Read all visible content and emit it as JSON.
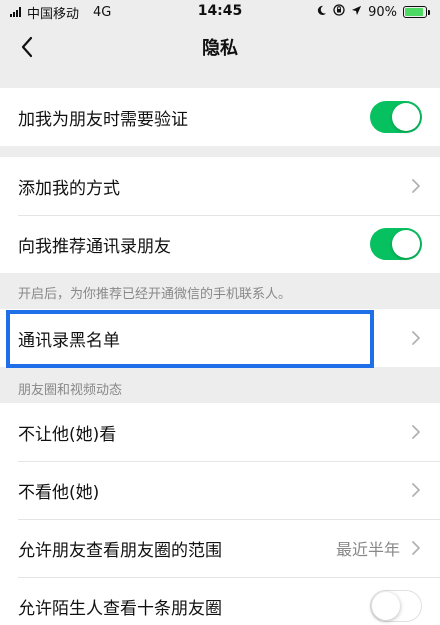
{
  "status_bar": {
    "carrier": "中国移动",
    "network": "4G",
    "time": "14:45",
    "battery_percent": "90%"
  },
  "nav": {
    "title": "隐私",
    "back_icon": "chevron-left-icon"
  },
  "group1": {
    "verify_label": "加我为朋友时需要验证",
    "verify_on": true
  },
  "group2": {
    "add_methods_label": "添加我的方式",
    "recommend_label": "向我推荐通讯录朋友",
    "recommend_on": true
  },
  "recommend_hint": "开启后，为你推荐已经开通微信的手机联系人。",
  "group3": {
    "blacklist_label": "通讯录黑名单"
  },
  "moments_section_title": "朋友圈和视频动态",
  "group4": {
    "hide_my_posts_label": "不让他(她)看",
    "hide_their_posts_label": "不看他(她)",
    "range_label": "允许朋友查看朋友圈的范围",
    "range_value": "最近半年",
    "stranger_label": "允许陌生人查看十条朋友圈",
    "stranger_on": false
  },
  "colors": {
    "toggle_on": "#07C160",
    "highlight_border": "#1E6FE8",
    "background": "#EDEDED"
  }
}
